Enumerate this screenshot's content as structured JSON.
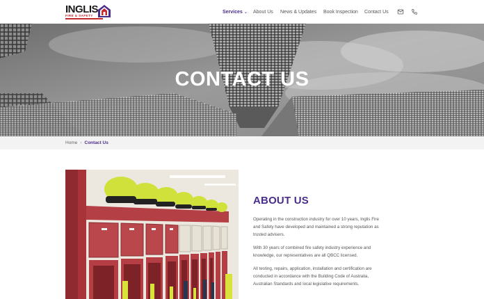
{
  "brand": {
    "name": "INGLIS",
    "tagline": "FIRE & SAFETY",
    "colors": {
      "primary": "#4a2d8a",
      "accent": "#c3262b"
    },
    "logo_icon": "house-icon"
  },
  "nav": {
    "items": [
      {
        "label": "Services",
        "active": true,
        "has_dropdown": true
      },
      {
        "label": "About Us"
      },
      {
        "label": "News & Updates"
      },
      {
        "label": "Book Inspection"
      },
      {
        "label": "Contact Us"
      }
    ],
    "icons": [
      "mail-icon",
      "phone-icon"
    ]
  },
  "hero": {
    "title": "CONTACT US"
  },
  "breadcrumb": {
    "home": "Home",
    "current": "Contact Us"
  },
  "about": {
    "title": "ABOUT US",
    "paragraphs": [
      "Operating in the construction industry for over 10 years, Inglis Fire and Safety have developed and maintained a strong reputation as trusted  advisers.",
      "With 30 years of combined fire safety industry experience and knowledge, our representatives are all QBCC licensed.",
      "All testing, repairs, application, installation and certification are conducted in accordance with the Building Code of Australia, Australian Standards and local legislative requirements."
    ]
  }
}
